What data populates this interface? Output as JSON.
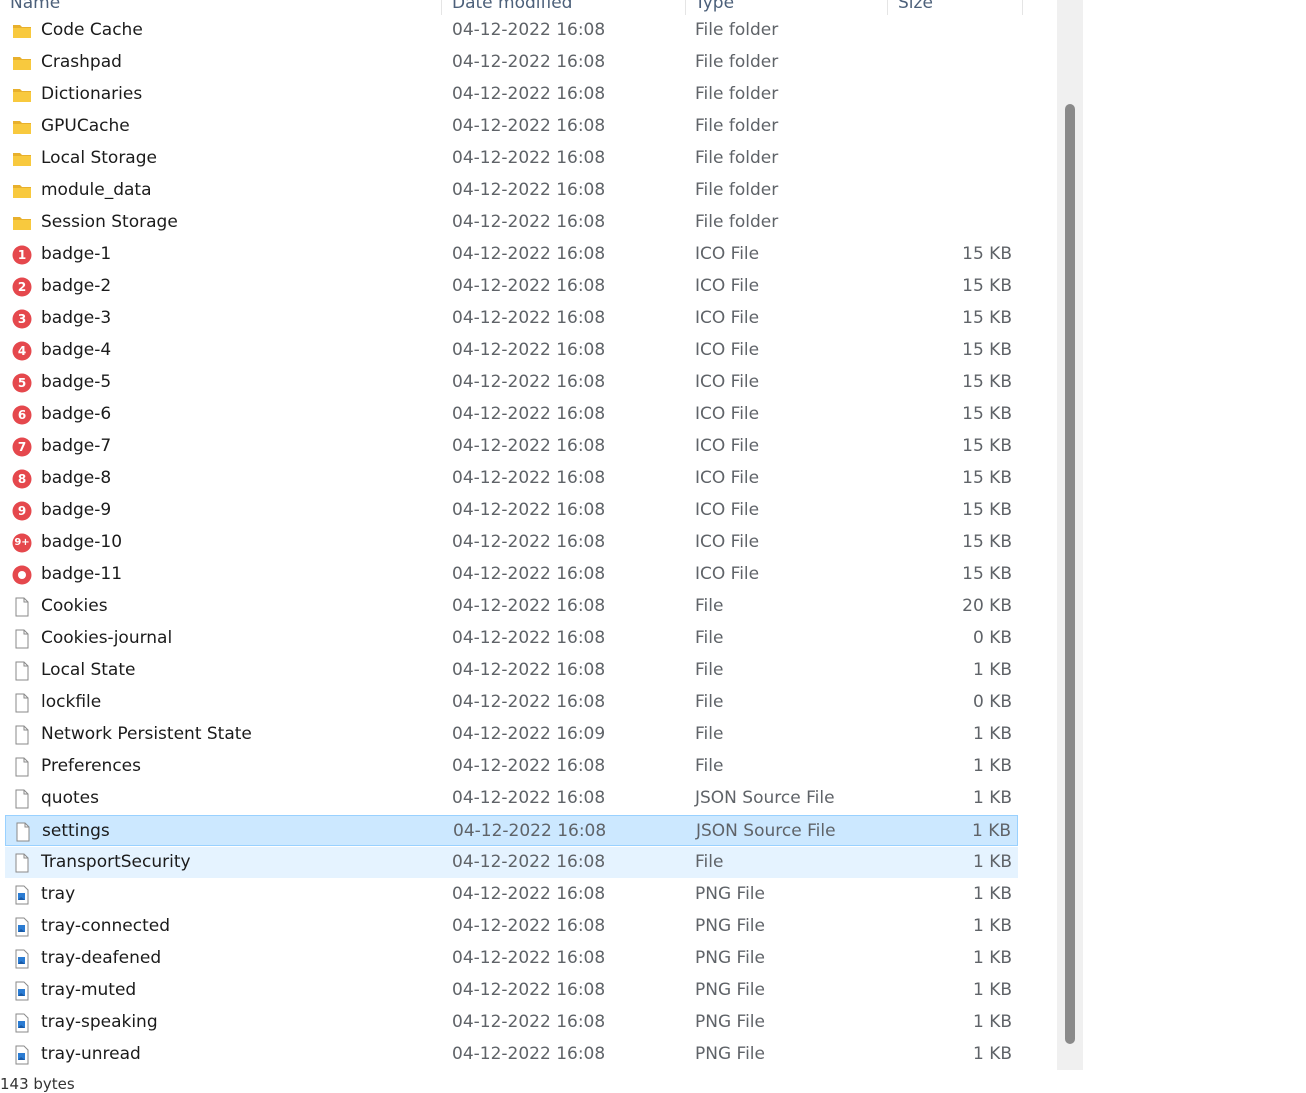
{
  "columns": {
    "name": "Name",
    "date": "Date modified",
    "type": "Type",
    "size": "Size"
  },
  "selected_index": 25,
  "hover_index": 26,
  "files": [
    {
      "name": "Code Cache",
      "date": "04-12-2022 16:08",
      "type": "File folder",
      "size": "",
      "icon": "folder-icon"
    },
    {
      "name": "Crashpad",
      "date": "04-12-2022 16:08",
      "type": "File folder",
      "size": "",
      "icon": "folder-icon"
    },
    {
      "name": "Dictionaries",
      "date": "04-12-2022 16:08",
      "type": "File folder",
      "size": "",
      "icon": "folder-icon"
    },
    {
      "name": "GPUCache",
      "date": "04-12-2022 16:08",
      "type": "File folder",
      "size": "",
      "icon": "folder-icon"
    },
    {
      "name": "Local Storage",
      "date": "04-12-2022 16:08",
      "type": "File folder",
      "size": "",
      "icon": "folder-icon"
    },
    {
      "name": "module_data",
      "date": "04-12-2022 16:08",
      "type": "File folder",
      "size": "",
      "icon": "folder-icon"
    },
    {
      "name": "Session Storage",
      "date": "04-12-2022 16:08",
      "type": "File folder",
      "size": "",
      "icon": "folder-icon"
    },
    {
      "name": "badge-1",
      "date": "04-12-2022 16:08",
      "type": "ICO File",
      "size": "15 KB",
      "icon": "badge-icon",
      "badge": "1"
    },
    {
      "name": "badge-2",
      "date": "04-12-2022 16:08",
      "type": "ICO File",
      "size": "15 KB",
      "icon": "badge-icon",
      "badge": "2"
    },
    {
      "name": "badge-3",
      "date": "04-12-2022 16:08",
      "type": "ICO File",
      "size": "15 KB",
      "icon": "badge-icon",
      "badge": "3"
    },
    {
      "name": "badge-4",
      "date": "04-12-2022 16:08",
      "type": "ICO File",
      "size": "15 KB",
      "icon": "badge-icon",
      "badge": "4"
    },
    {
      "name": "badge-5",
      "date": "04-12-2022 16:08",
      "type": "ICO File",
      "size": "15 KB",
      "icon": "badge-icon",
      "badge": "5"
    },
    {
      "name": "badge-6",
      "date": "04-12-2022 16:08",
      "type": "ICO File",
      "size": "15 KB",
      "icon": "badge-icon",
      "badge": "6"
    },
    {
      "name": "badge-7",
      "date": "04-12-2022 16:08",
      "type": "ICO File",
      "size": "15 KB",
      "icon": "badge-icon",
      "badge": "7"
    },
    {
      "name": "badge-8",
      "date": "04-12-2022 16:08",
      "type": "ICO File",
      "size": "15 KB",
      "icon": "badge-icon",
      "badge": "8"
    },
    {
      "name": "badge-9",
      "date": "04-12-2022 16:08",
      "type": "ICO File",
      "size": "15 KB",
      "icon": "badge-icon",
      "badge": "9"
    },
    {
      "name": "badge-10",
      "date": "04-12-2022 16:08",
      "type": "ICO File",
      "size": "15 KB",
      "icon": "badge-icon",
      "badge": "9+"
    },
    {
      "name": "badge-11",
      "date": "04-12-2022 16:08",
      "type": "ICO File",
      "size": "15 KB",
      "icon": "badge-dot-icon",
      "badge": ""
    },
    {
      "name": "Cookies",
      "date": "04-12-2022 16:08",
      "type": "File",
      "size": "20 KB",
      "icon": "file-icon"
    },
    {
      "name": "Cookies-journal",
      "date": "04-12-2022 16:08",
      "type": "File",
      "size": "0 KB",
      "icon": "file-icon"
    },
    {
      "name": "Local State",
      "date": "04-12-2022 16:08",
      "type": "File",
      "size": "1 KB",
      "icon": "file-icon"
    },
    {
      "name": "lockfile",
      "date": "04-12-2022 16:08",
      "type": "File",
      "size": "0 KB",
      "icon": "file-icon"
    },
    {
      "name": "Network Persistent State",
      "date": "04-12-2022 16:09",
      "type": "File",
      "size": "1 KB",
      "icon": "file-icon"
    },
    {
      "name": "Preferences",
      "date": "04-12-2022 16:08",
      "type": "File",
      "size": "1 KB",
      "icon": "file-icon"
    },
    {
      "name": "quotes",
      "date": "04-12-2022 16:08",
      "type": "JSON Source File",
      "size": "1 KB",
      "icon": "file-icon"
    },
    {
      "name": "settings",
      "date": "04-12-2022 16:08",
      "type": "JSON Source File",
      "size": "1 KB",
      "icon": "file-icon"
    },
    {
      "name": "TransportSecurity",
      "date": "04-12-2022 16:08",
      "type": "File",
      "size": "1 KB",
      "icon": "file-icon"
    },
    {
      "name": "tray",
      "date": "04-12-2022 16:08",
      "type": "PNG File",
      "size": "1 KB",
      "icon": "image-file-icon"
    },
    {
      "name": "tray-connected",
      "date": "04-12-2022 16:08",
      "type": "PNG File",
      "size": "1 KB",
      "icon": "image-file-icon"
    },
    {
      "name": "tray-deafened",
      "date": "04-12-2022 16:08",
      "type": "PNG File",
      "size": "1 KB",
      "icon": "image-file-icon"
    },
    {
      "name": "tray-muted",
      "date": "04-12-2022 16:08",
      "type": "PNG File",
      "size": "1 KB",
      "icon": "image-file-icon"
    },
    {
      "name": "tray-speaking",
      "date": "04-12-2022 16:08",
      "type": "PNG File",
      "size": "1 KB",
      "icon": "image-file-icon"
    },
    {
      "name": "tray-unread",
      "date": "04-12-2022 16:08",
      "type": "PNG File",
      "size": "1 KB",
      "icon": "image-file-icon"
    }
  ],
  "status_bar": {
    "text": "143 bytes"
  },
  "colors": {
    "selected_bg": "#cce8ff",
    "selected_border": "#99d1ff",
    "hover_bg": "#e5f3ff",
    "badge_red": "#e5484d",
    "folder_yellow": "#f8c93e"
  }
}
